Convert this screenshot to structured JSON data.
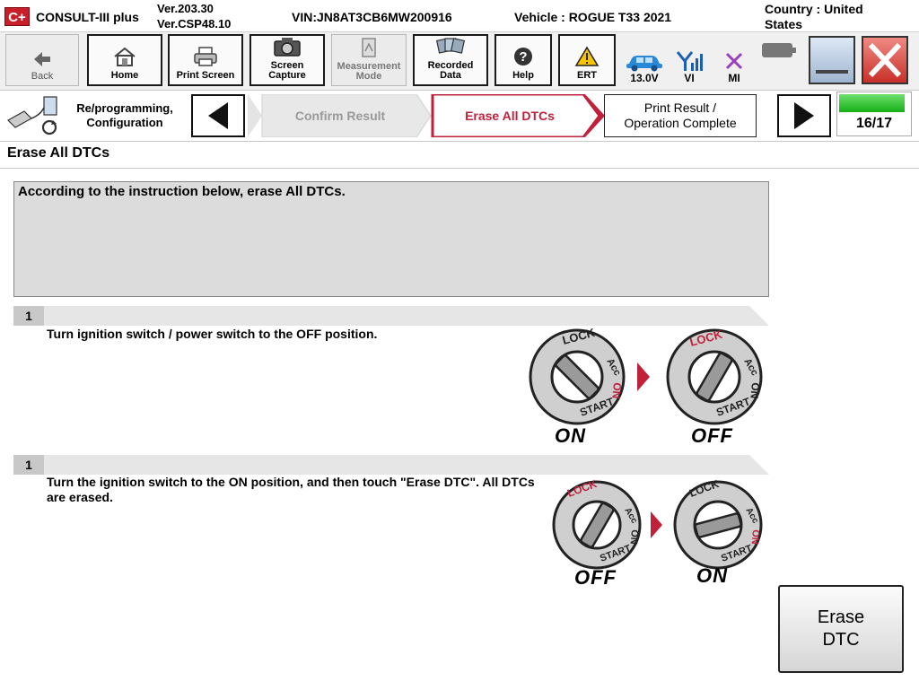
{
  "app": {
    "logo_text": "C+",
    "name": "CONSULT-III plus",
    "version1": "Ver.203.30",
    "version2": "Ver.CSP48.10",
    "vin": "VIN:JN8AT3CB6MW200916",
    "vehicle": "Vehicle : ROGUE T33 2021",
    "country1": "Country : United",
    "country2": "States"
  },
  "toolbar": {
    "back": "Back",
    "home": "Home",
    "print_screen": "Print Screen",
    "screen_capture1": "Screen",
    "screen_capture2": "Capture",
    "measurement1": "Measurement",
    "measurement2": "Mode",
    "recorded1": "Recorded",
    "recorded2": "Data",
    "help": "Help",
    "ert": "ERT",
    "voltage": "13.0V",
    "vi": "VI",
    "mi": "MI"
  },
  "stepnav": {
    "category1": "Re/programming,",
    "category2": "Configuration",
    "prev_step": "Confirm Result",
    "current_step": "Erase All DTCs",
    "next_step1": "Print Result /",
    "next_step2": "Operation Complete",
    "progress_text": "16/17",
    "progress_fraction": 0.94
  },
  "content": {
    "title": "Erase All DTCs",
    "instruction": "According to the instruction below, erase All DTCs.",
    "step1_num": "1",
    "step1_text": "Turn ignition switch / power switch to the OFF position.",
    "step2_num": "1",
    "step2_text": "Turn the ignition switch to the ON position, and then touch \"Erase DTC\". All DTCs are erased.",
    "img1_from": "ON",
    "img1_to": "OFF",
    "img2_from": "OFF",
    "img2_to": "ON",
    "dial_lock": "LOCK",
    "dial_acc": "Acc",
    "dial_on": "ON",
    "dial_start": "START",
    "erase_btn1": "Erase",
    "erase_btn2": "DTC"
  },
  "colors": {
    "accent_red": "#c8202a",
    "current_step_border": "#c0203a",
    "progress_green": "#16b016"
  }
}
